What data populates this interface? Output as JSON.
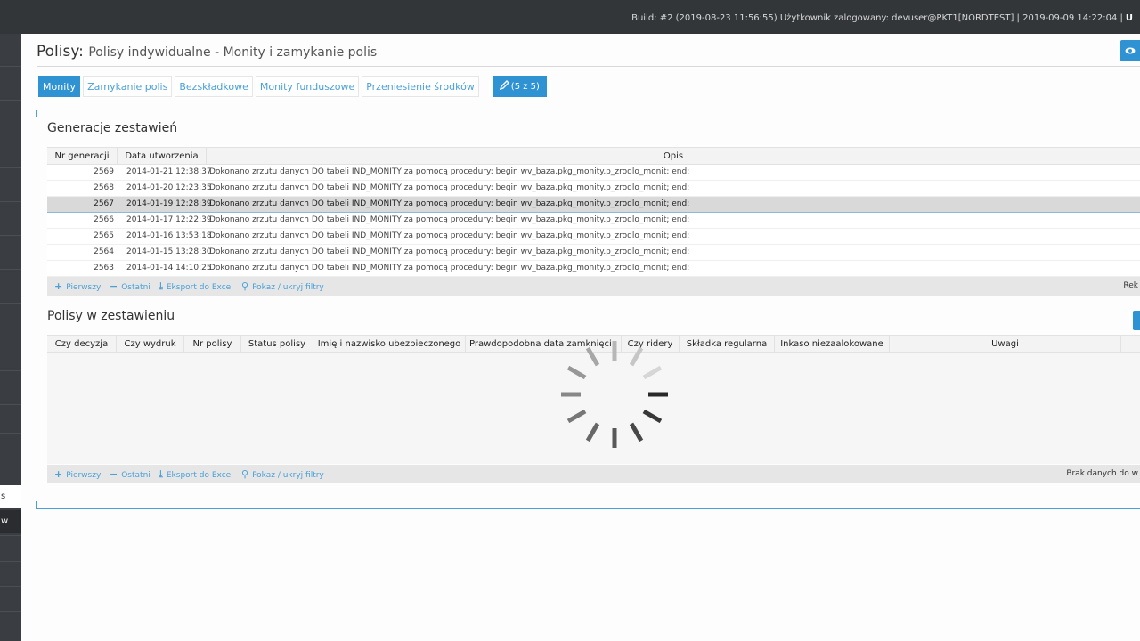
{
  "topbar": {
    "build_info": "Build: #2 (2019-08-23 11:56:55)   Użytkownik zalogowany: devuser@PKT1[NORDTEST] | 2019-09-09 14:22:04 |",
    "tail": "U"
  },
  "sidebar": {
    "item_s": "s",
    "item_w": "w"
  },
  "page": {
    "title_main": "Polisy:",
    "title_sub": "Polisy indywidualne - Monity i zamykanie polis"
  },
  "tabs": [
    {
      "label": "Monity",
      "active": true
    },
    {
      "label": "Zamykanie polis",
      "active": false
    },
    {
      "label": "Bezskładkowe",
      "active": false
    },
    {
      "label": "Monity funduszowe",
      "active": false
    },
    {
      "label": "Przeniesienie środków",
      "active": false
    }
  ],
  "tab_counter": {
    "label": "(5 z 5)",
    "icon": "pencil-icon"
  },
  "grid1": {
    "title": "Generacje zestawień",
    "columns": [
      "Nr generacji",
      "Data utworzenia",
      "Opis"
    ],
    "rows": [
      {
        "nr": "2569",
        "date": "2014-01-21 12:38:37",
        "desc": "Dokonano zrzutu danych DO tabeli IND_MONITY za pomocą procedury: begin wv_baza.pkg_monity.p_zrodlo_monit; end;"
      },
      {
        "nr": "2568",
        "date": "2014-01-20 12:23:35",
        "desc": "Dokonano zrzutu danych DO tabeli IND_MONITY za pomocą procedury: begin wv_baza.pkg_monity.p_zrodlo_monit; end;"
      },
      {
        "nr": "2567",
        "date": "2014-01-19 12:28:39",
        "desc": "Dokonano zrzutu danych DO tabeli IND_MONITY za pomocą procedury: begin wv_baza.pkg_monity.p_zrodlo_monit; end;",
        "selected": true
      },
      {
        "nr": "2566",
        "date": "2014-01-17 12:22:39",
        "desc": "Dokonano zrzutu danych DO tabeli IND_MONITY za pomocą procedury: begin wv_baza.pkg_monity.p_zrodlo_monit; end;"
      },
      {
        "nr": "2565",
        "date": "2014-01-16 13:53:18",
        "desc": "Dokonano zrzutu danych DO tabeli IND_MONITY za pomocą procedury: begin wv_baza.pkg_monity.p_zrodlo_monit; end;"
      },
      {
        "nr": "2564",
        "date": "2014-01-15 13:28:30",
        "desc": "Dokonano zrzutu danych DO tabeli IND_MONITY za pomocą procedury: begin wv_baza.pkg_monity.p_zrodlo_monit; end;"
      },
      {
        "nr": "2563",
        "date": "2014-01-14 14:10:25",
        "desc": "Dokonano zrzutu danych DO tabeli IND_MONITY za pomocą procedury: begin wv_baza.pkg_monity.p_zrodlo_monit; end;"
      }
    ],
    "footer": {
      "first": "Pierwszy",
      "last": "Ostatni",
      "export": "Eksport do Excel",
      "filters": "Pokaż / ukryj filtry",
      "right": "Rek"
    }
  },
  "grid2": {
    "title": "Polisy w zestawieniu",
    "columns": [
      "Czy decyzja",
      "Czy wydruk",
      "Nr polisy",
      "Status polisy",
      "Imię i nazwisko ubezpieczonego",
      "Prawdopodobna data zamknięcia",
      "Czy ridery",
      "Składka regularna",
      "Inkaso niezaalokowane",
      "Uwagi"
    ],
    "footer": {
      "first": "Pierwszy",
      "last": "Ostatni",
      "export": "Eksport do Excel",
      "filters": "Pokaż / ukryj filtry",
      "right": "Brak danych do w"
    }
  },
  "icons": {
    "eye": "eye-icon",
    "plus": "plus-icon",
    "minus": "minus-icon",
    "download": "download-icon",
    "search": "search-icon"
  },
  "colors": {
    "accent": "#2f93d3",
    "topbar": "#333639",
    "sidebar": "#3a3d41"
  }
}
